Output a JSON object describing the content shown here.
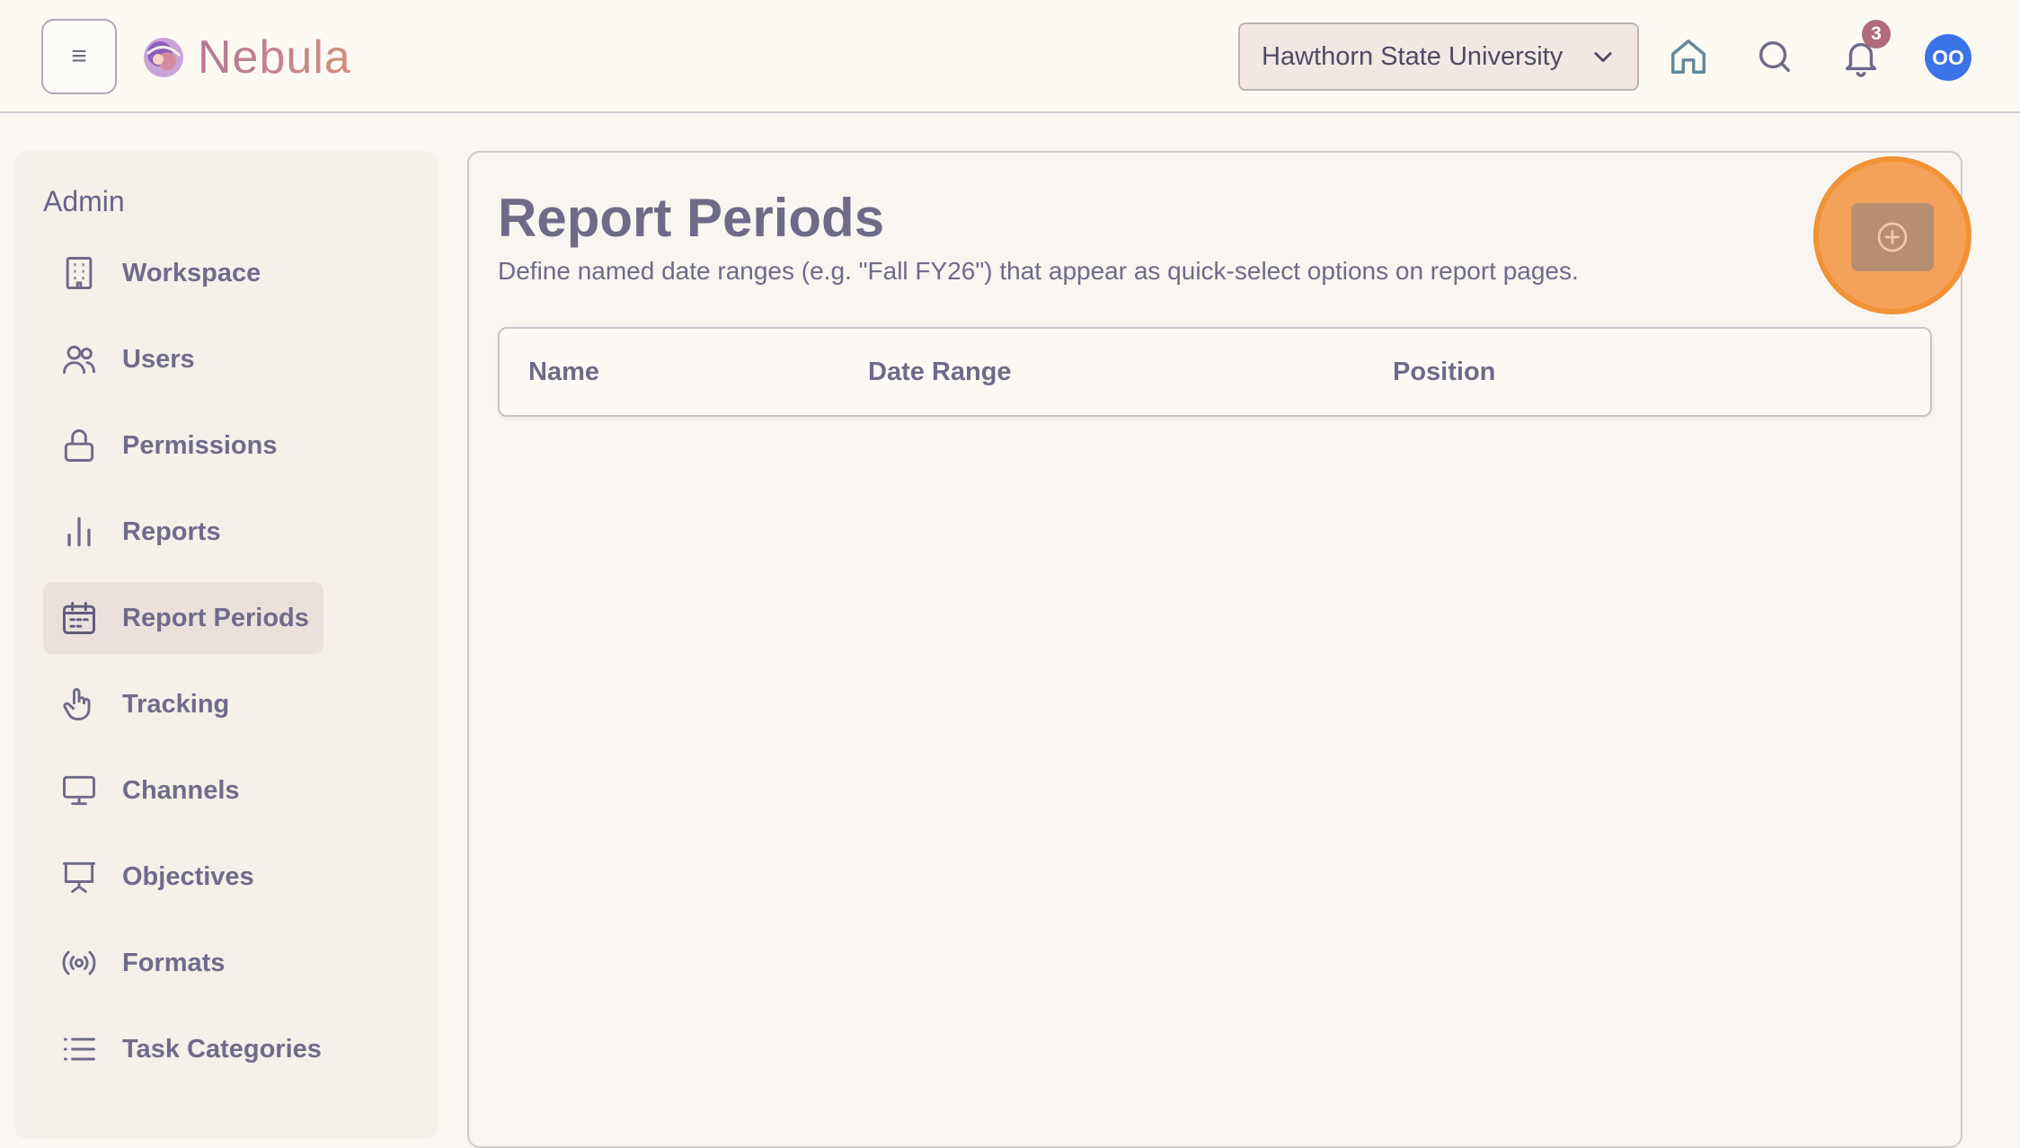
{
  "header": {
    "menu_glyph": "≡",
    "app_name": "Nebula",
    "org_selector": "Hawthorn State University",
    "notification_count": "3",
    "avatar_initials": "OO"
  },
  "sidebar": {
    "heading": "Admin",
    "items": [
      {
        "label": "Workspace",
        "icon": "building-icon"
      },
      {
        "label": "Users",
        "icon": "users-icon"
      },
      {
        "label": "Permissions",
        "icon": "lock-icon"
      },
      {
        "label": "Reports",
        "icon": "bar-chart-icon"
      },
      {
        "label": "Report Periods",
        "icon": "calendar-icon",
        "active": true
      },
      {
        "label": "Tracking",
        "icon": "pointer-hand-icon"
      },
      {
        "label": "Channels",
        "icon": "monitor-icon"
      },
      {
        "label": "Objectives",
        "icon": "presentation-icon"
      },
      {
        "label": "Formats",
        "icon": "broadcast-icon"
      },
      {
        "label": "Task Categories",
        "icon": "list-icon"
      }
    ]
  },
  "main": {
    "title": "Report Periods",
    "subtitle": "Define named date ranges (e.g. \"Fall FY26\") that appear as quick-select options on report pages.",
    "table": {
      "columns": [
        "Name",
        "Date Range",
        "Position"
      ]
    }
  },
  "colors": {
    "accent_highlight": "#f4a15a",
    "add_button": "#b58f70",
    "avatar": "#3b74e6",
    "badge": "#b06a7a"
  }
}
